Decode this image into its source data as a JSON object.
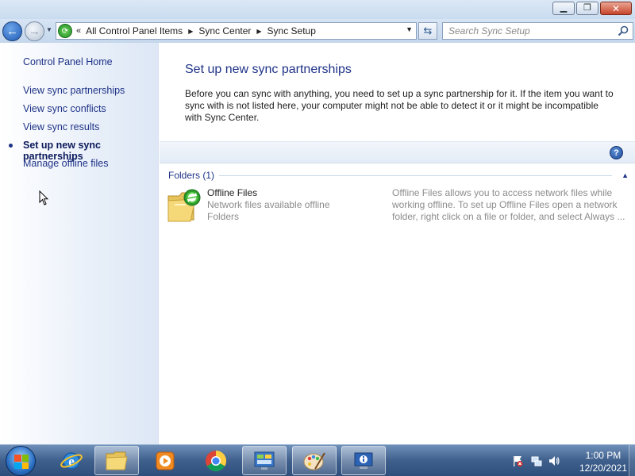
{
  "window": {
    "minimize_glyph": "▁",
    "maximize_glyph": "❐",
    "close_glyph": "✕"
  },
  "navbar": {
    "breadcrumb": [
      "All Control Panel Items",
      "Sync Center",
      "Sync Setup"
    ],
    "overflow_glyph": "«",
    "search_placeholder": "Search Sync Setup"
  },
  "sidebar": {
    "home": "Control Panel Home",
    "items": [
      {
        "label": "View sync partnerships",
        "active": false
      },
      {
        "label": "View sync conflicts",
        "active": false
      },
      {
        "label": "View sync results",
        "active": false
      },
      {
        "label": "Set up new sync partnerships",
        "active": true
      },
      {
        "label": "Manage offline files",
        "active": false
      }
    ]
  },
  "main": {
    "title": "Set up new sync partnerships",
    "description": "Before you can sync with anything, you need to set up a sync partnership for it. If the item you want to sync with is not listed here, your computer might not be able to detect it or it might be incompatible with Sync Center.",
    "help_glyph": "?",
    "group": {
      "label": "Folders (1)",
      "items": [
        {
          "name": "Offline Files",
          "subtitle": "Network files available offline",
          "type": "Folders",
          "description": "Offline Files allows you to access network files while working offline. To set up Offline Files open a network folder, right click on a file or folder, and select Always ..."
        }
      ]
    }
  },
  "taskbar": {
    "apps": [
      "internet-explorer",
      "file-explorer",
      "media-player",
      "chrome",
      "control-panel",
      "paint",
      "system-information"
    ],
    "time": "1:00 PM",
    "date": "12/20/2021"
  },
  "colors": {
    "link": "#1e3287",
    "sidebar_bg": "#e8eff9",
    "taskbar": "#3f5f8c"
  }
}
